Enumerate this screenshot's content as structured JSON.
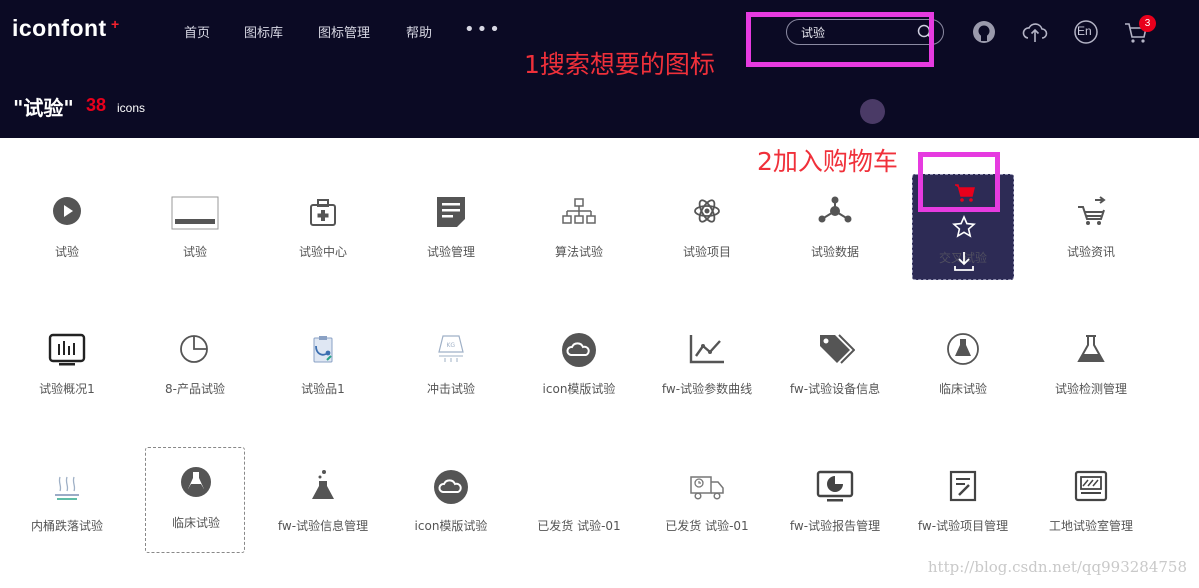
{
  "header": {
    "logo": "iconfont",
    "logo_mark": "+",
    "nav": [
      {
        "label": "首页"
      },
      {
        "label": "图标库"
      },
      {
        "label": "图标管理"
      },
      {
        "label": "帮助"
      }
    ],
    "more_label": "•••",
    "search": {
      "value": "试验",
      "placeholder": ""
    },
    "lang_label": "En",
    "cart_count": "3"
  },
  "results": {
    "title": "\"试验\"",
    "count": "38",
    "unit": "icons"
  },
  "annotations": {
    "step1": "1搜索想要的图标",
    "step2": "2加入购物车"
  },
  "hover_card": {
    "label": "交叉试验",
    "cart_color": "#e8001c"
  },
  "icons": [
    {
      "label": "试验",
      "icon": "play-circle-icon"
    },
    {
      "label": "试验",
      "icon": "banner-icon"
    },
    {
      "label": "试验中心",
      "icon": "medical-bag-icon"
    },
    {
      "label": "试验管理",
      "icon": "document-icon"
    },
    {
      "label": "算法试验",
      "icon": "org-tree-icon"
    },
    {
      "label": "试验项目",
      "icon": "atom-icon"
    },
    {
      "label": "试验数据",
      "icon": "network-icon"
    },
    {
      "label": "交叉试验",
      "icon": "hover-card"
    },
    {
      "label": "试验资讯",
      "icon": "cart-arrow-icon"
    },
    {
      "label": "试验概况1",
      "icon": "monitor-bars-icon"
    },
    {
      "label": "8-产品试验",
      "icon": "pie-icon"
    },
    {
      "label": "试验品1",
      "icon": "clipboard-stethoscope-icon"
    },
    {
      "label": "冲击试验",
      "icon": "weight-kg-icon"
    },
    {
      "label": "icon模版试验",
      "icon": "cloud-circle-icon"
    },
    {
      "label": "fw-试验参数曲线",
      "icon": "line-chart-icon"
    },
    {
      "label": "fw-试验设备信息",
      "icon": "tags-icon"
    },
    {
      "label": "临床试验",
      "icon": "flask-circle-outline-icon"
    },
    {
      "label": "试验检测管理",
      "icon": "flask-icon"
    },
    {
      "label": "内桶跌落试验",
      "icon": "drop-test-icon"
    },
    {
      "label": "临床试验",
      "icon": "flask-circle-filled-icon"
    },
    {
      "label": "fw-试验信息管理",
      "icon": "flask-bubbles-icon"
    },
    {
      "label": "icon模版试验",
      "icon": "cloud-circle-icon"
    },
    {
      "label": "已发货 试验-01",
      "icon": "none"
    },
    {
      "label": "已发货 试验-01",
      "icon": "truck-clock-icon"
    },
    {
      "label": "fw-试验报告管理",
      "icon": "report-monitor-icon"
    },
    {
      "label": "fw-试验项目管理",
      "icon": "note-pen-icon"
    },
    {
      "label": "工地试验室管理",
      "icon": "lab-cabinet-icon"
    }
  ],
  "watermark": "http://blog.csdn.net/qq993284758"
}
